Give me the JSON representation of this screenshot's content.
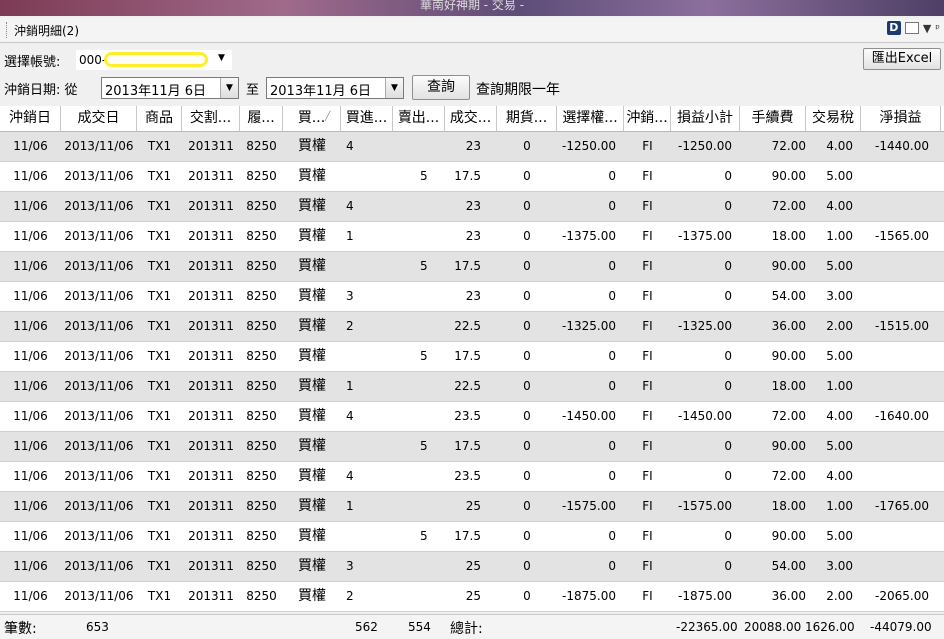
{
  "window": {
    "title": "華南好神期 - 交易 -"
  },
  "panel": {
    "title": "沖銷明細(2)"
  },
  "toolbar": {
    "account_label": "選擇帳號:",
    "account_value": "000-",
    "export_button": "匯出Excel",
    "date_label": "沖銷日期: 從",
    "date_from": "2013年11月  6日",
    "to_label": "至",
    "date_to": "2013年11月  6日",
    "query_button": "查詢",
    "query_limit_text": "查詢期限一年"
  },
  "table": {
    "columns": [
      "沖銷日",
      "成交日",
      "商品",
      "交割...",
      "履...",
      "買...",
      "買進...",
      "賣出...",
      "成交...",
      "期貨...",
      "選擇權...",
      "沖銷...",
      "損益小計",
      "手續費",
      "交易稅",
      "淨損益"
    ],
    "rows": [
      [
        "11/06",
        "2013/11/06",
        "TX1",
        "201311",
        "8250",
        "買權",
        "4",
        "",
        "23",
        "0",
        "-1250.00",
        "FI",
        "-1250.00",
        "72.00",
        "4.00",
        "-1440.00"
      ],
      [
        "11/06",
        "2013/11/06",
        "TX1",
        "201311",
        "8250",
        "買權",
        "",
        "5",
        "17.5",
        "0",
        "0",
        "FI",
        "0",
        "90.00",
        "5.00",
        ""
      ],
      [
        "11/06",
        "2013/11/06",
        "TX1",
        "201311",
        "8250",
        "買權",
        "4",
        "",
        "23",
        "0",
        "0",
        "FI",
        "0",
        "72.00",
        "4.00",
        ""
      ],
      [
        "11/06",
        "2013/11/06",
        "TX1",
        "201311",
        "8250",
        "買權",
        "1",
        "",
        "23",
        "0",
        "-1375.00",
        "FI",
        "-1375.00",
        "18.00",
        "1.00",
        "-1565.00"
      ],
      [
        "11/06",
        "2013/11/06",
        "TX1",
        "201311",
        "8250",
        "買權",
        "",
        "5",
        "17.5",
        "0",
        "0",
        "FI",
        "0",
        "90.00",
        "5.00",
        ""
      ],
      [
        "11/06",
        "2013/11/06",
        "TX1",
        "201311",
        "8250",
        "買權",
        "3",
        "",
        "23",
        "0",
        "0",
        "FI",
        "0",
        "54.00",
        "3.00",
        ""
      ],
      [
        "11/06",
        "2013/11/06",
        "TX1",
        "201311",
        "8250",
        "買權",
        "2",
        "",
        "22.5",
        "0",
        "-1325.00",
        "FI",
        "-1325.00",
        "36.00",
        "2.00",
        "-1515.00"
      ],
      [
        "11/06",
        "2013/11/06",
        "TX1",
        "201311",
        "8250",
        "買權",
        "",
        "5",
        "17.5",
        "0",
        "0",
        "FI",
        "0",
        "90.00",
        "5.00",
        ""
      ],
      [
        "11/06",
        "2013/11/06",
        "TX1",
        "201311",
        "8250",
        "買權",
        "1",
        "",
        "22.5",
        "0",
        "0",
        "FI",
        "0",
        "18.00",
        "1.00",
        ""
      ],
      [
        "11/06",
        "2013/11/06",
        "TX1",
        "201311",
        "8250",
        "買權",
        "4",
        "",
        "23.5",
        "0",
        "-1450.00",
        "FI",
        "-1450.00",
        "72.00",
        "4.00",
        "-1640.00"
      ],
      [
        "11/06",
        "2013/11/06",
        "TX1",
        "201311",
        "8250",
        "買權",
        "",
        "5",
        "17.5",
        "0",
        "0",
        "FI",
        "0",
        "90.00",
        "5.00",
        ""
      ],
      [
        "11/06",
        "2013/11/06",
        "TX1",
        "201311",
        "8250",
        "買權",
        "4",
        "",
        "23.5",
        "0",
        "0",
        "FI",
        "0",
        "72.00",
        "4.00",
        ""
      ],
      [
        "11/06",
        "2013/11/06",
        "TX1",
        "201311",
        "8250",
        "買權",
        "1",
        "",
        "25",
        "0",
        "-1575.00",
        "FI",
        "-1575.00",
        "18.00",
        "1.00",
        "-1765.00"
      ],
      [
        "11/06",
        "2013/11/06",
        "TX1",
        "201311",
        "8250",
        "買權",
        "",
        "5",
        "17.5",
        "0",
        "0",
        "FI",
        "0",
        "90.00",
        "5.00",
        ""
      ],
      [
        "11/06",
        "2013/11/06",
        "TX1",
        "201311",
        "8250",
        "買權",
        "3",
        "",
        "25",
        "0",
        "0",
        "FI",
        "0",
        "54.00",
        "3.00",
        ""
      ],
      [
        "11/06",
        "2013/11/06",
        "TX1",
        "201311",
        "8250",
        "買權",
        "2",
        "",
        "25",
        "0",
        "-1875.00",
        "FI",
        "-1875.00",
        "36.00",
        "2.00",
        "-2065.00"
      ]
    ]
  },
  "footer": {
    "count_label": "筆數:",
    "count_value": "653",
    "buy_total": "562",
    "sell_total": "554",
    "total_label": "總計:",
    "pl_total": "-22365.00",
    "fee_total": "20088.00",
    "tax_total": "1626.00",
    "net_total": "-44079.00"
  },
  "icons": {
    "app": "d-logo-icon",
    "window": "window-icon",
    "dropdown": "chevron-down-icon",
    "pin": "pin-icon",
    "sort": "sort-icon"
  }
}
